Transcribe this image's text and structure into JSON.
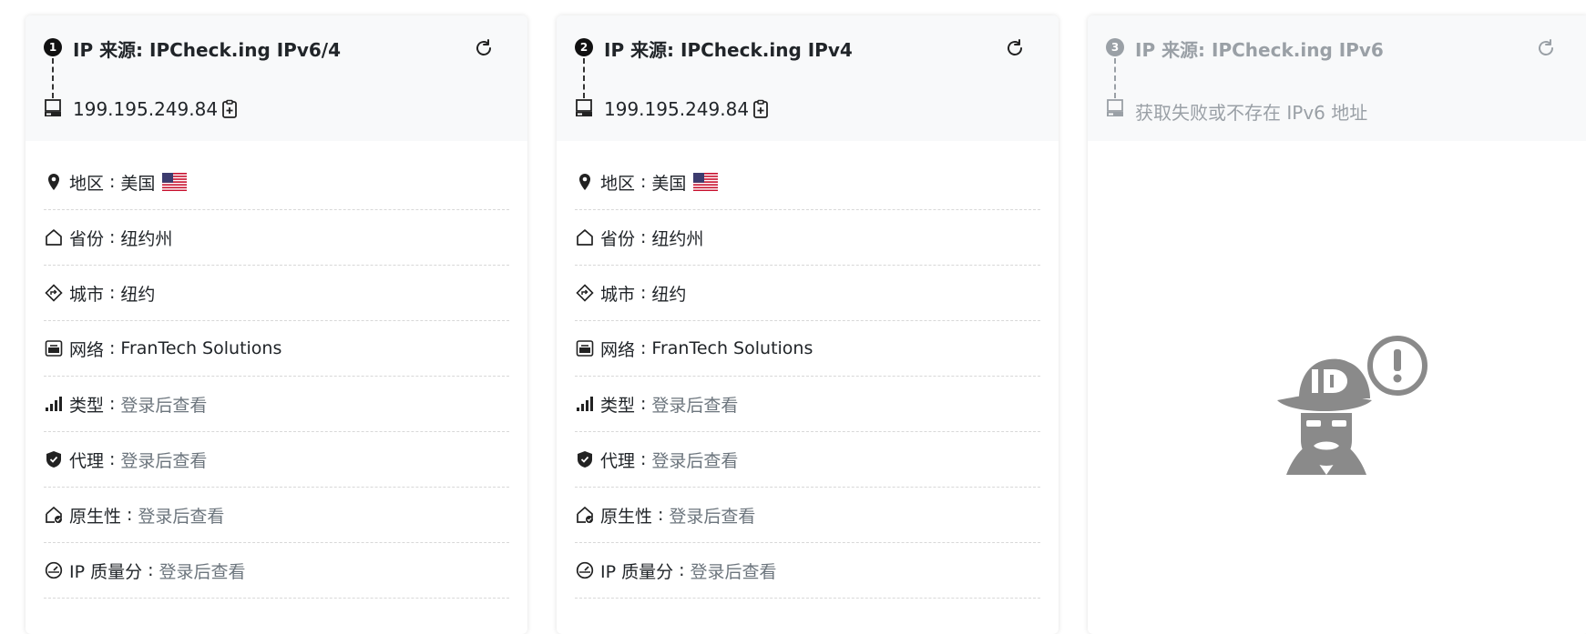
{
  "cards": [
    {
      "number": "1",
      "title": "IP 来源: IPCheck.ing IPv6/4",
      "ip": "199.195.249.84",
      "rows": [
        {
          "label": "地区",
          "value": "美国",
          "muted": false,
          "icon": "map-pin-icon",
          "flag": "us-flag"
        },
        {
          "label": "省份",
          "value": "纽约州",
          "muted": false,
          "icon": "house-icon"
        },
        {
          "label": "城市",
          "value": "纽约",
          "muted": false,
          "icon": "signpost-icon"
        },
        {
          "label": "网络",
          "value": "FranTech Solutions",
          "muted": false,
          "icon": "network-icon"
        },
        {
          "label": "类型",
          "value": "登录后查看",
          "muted": true,
          "icon": "signal-bars-icon"
        },
        {
          "label": "代理",
          "value": "登录后查看",
          "muted": true,
          "icon": "shield-check-icon"
        },
        {
          "label": "原生性",
          "value": "登录后查看",
          "muted": true,
          "icon": "house-check-icon"
        },
        {
          "label": "IP 质量分",
          "value": "登录后查看",
          "muted": true,
          "icon": "speedometer-icon"
        }
      ]
    },
    {
      "number": "2",
      "title": "IP 来源: IPCheck.ing IPv4",
      "ip": "199.195.249.84",
      "rows": [
        {
          "label": "地区",
          "value": "美国",
          "muted": false,
          "icon": "map-pin-icon",
          "flag": "us-flag"
        },
        {
          "label": "省份",
          "value": "纽约州",
          "muted": false,
          "icon": "house-icon"
        },
        {
          "label": "城市",
          "value": "纽约",
          "muted": false,
          "icon": "signpost-icon"
        },
        {
          "label": "网络",
          "value": "FranTech Solutions",
          "muted": false,
          "icon": "network-icon"
        },
        {
          "label": "类型",
          "value": "登录后查看",
          "muted": true,
          "icon": "signal-bars-icon"
        },
        {
          "label": "代理",
          "value": "登录后查看",
          "muted": true,
          "icon": "shield-check-icon"
        },
        {
          "label": "原生性",
          "value": "登录后查看",
          "muted": true,
          "icon": "house-check-icon"
        },
        {
          "label": "IP 质量分",
          "value": "登录后查看",
          "muted": true,
          "icon": "speedometer-icon"
        }
      ]
    },
    {
      "number": "3",
      "title": "IP 来源: IPCheck.ing IPv6",
      "ip": "获取失败或不存在 IPv6 地址",
      "disabled": true,
      "empty_icon": "not-found-detective-icon"
    }
  ],
  "colors": {
    "header_bg": "#f8f9fa",
    "text": "#212529",
    "muted": "#6c757d",
    "disabled": "#9aa0a6"
  }
}
